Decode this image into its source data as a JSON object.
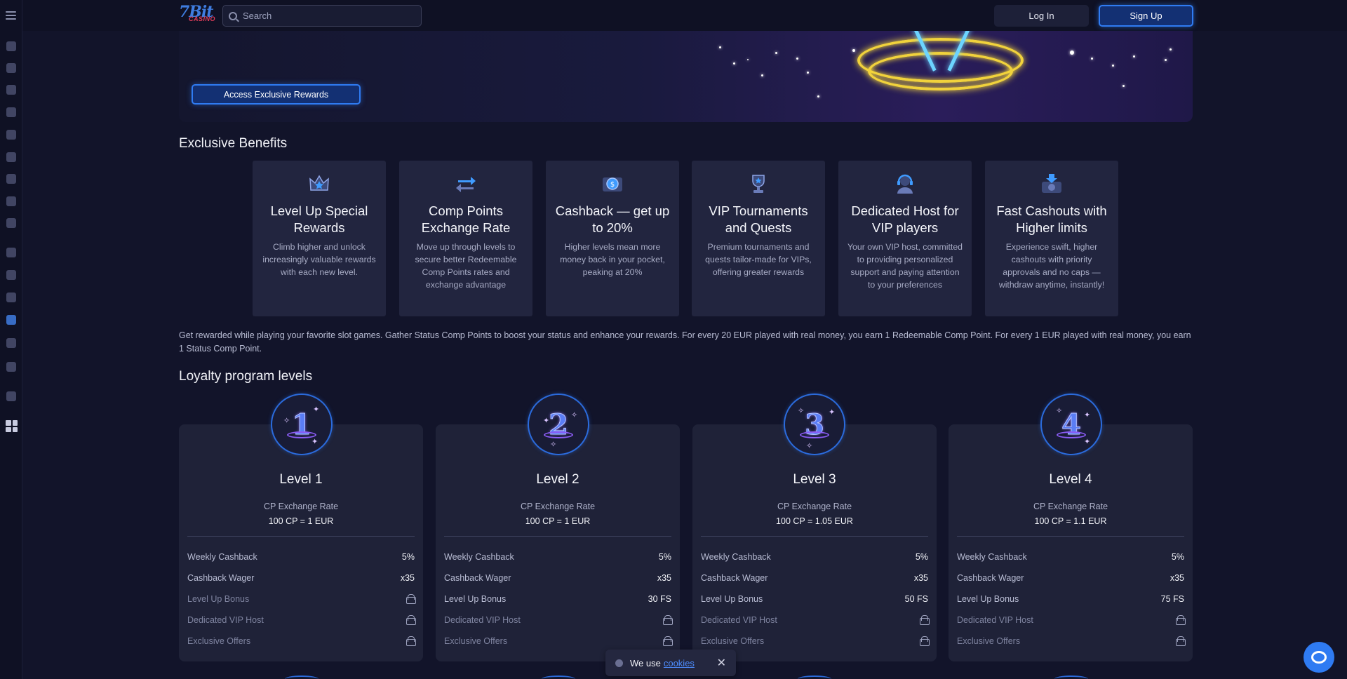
{
  "header": {
    "logo_text": "7Bit",
    "logo_sub": "CASINO",
    "search_placeholder": "Search",
    "login_label": "Log In",
    "signup_label": "Sign Up"
  },
  "hero": {
    "cta_label": "Access Exclusive Rewards"
  },
  "benefits": {
    "title": "Exclusive Benefits",
    "items": [
      {
        "icon": "crown-icon",
        "title": "Level Up Special Rewards",
        "text": "Climb higher and unlock increasingly valuable rewards with each new level."
      },
      {
        "icon": "exchange-arrows-icon",
        "title": "Comp Points Exchange Rate",
        "text": "Move up through levels to secure better Redeemable Comp Points rates and exchange advantage"
      },
      {
        "icon": "cashback-coin-icon",
        "title": "Cashback — get up to 20%",
        "text": "Higher levels mean more money back in your pocket, peaking at 20%"
      },
      {
        "icon": "trophy-icon",
        "title": "VIP Tournaments and Quests",
        "text": "Premium tournaments and quests tailor-made for VIPs, offering greater rewards"
      },
      {
        "icon": "support-agent-icon",
        "title": "Dedicated Host for VIP players",
        "text": "Your own VIP host, committed to providing personalized support and paying attention to your preferences"
      },
      {
        "icon": "cash-out-icon",
        "title": "Fast Cashouts with Higher limits",
        "text": "Experience swift, higher cashouts with priority approvals and no caps — withdraw anytime, instantly!"
      }
    ]
  },
  "description": "Get rewarded while playing your favorite slot games. Gather Status Comp Points to boost your status and enhance your rewards. For every 20 EUR played with real money, you earn 1 Redeemable Comp Point. For every 1 EUR played with real money, you earn 1 Status Comp Point.",
  "levels": {
    "title": "Loyalty program levels",
    "cp_label": "CP Exchange Rate",
    "row_labels": {
      "weekly_cashback": "Weekly Cashback",
      "cashback_wager": "Cashback Wager",
      "level_up_bonus": "Level Up Bonus",
      "vip_host": "Dedicated VIP Host",
      "exclusive_offers": "Exclusive Offers"
    },
    "items": [
      {
        "number": "1",
        "name": "Level 1",
        "cp_rate": "100 CP = 1 EUR",
        "weekly_cashback": "5%",
        "cashback_wager": "x35",
        "level_up_bonus": null
      },
      {
        "number": "2",
        "name": "Level 2",
        "cp_rate": "100 CP = 1 EUR",
        "weekly_cashback": "5%",
        "cashback_wager": "x35",
        "level_up_bonus": "30 FS"
      },
      {
        "number": "3",
        "name": "Level 3",
        "cp_rate": "100 CP = 1.05 EUR",
        "weekly_cashback": "5%",
        "cashback_wager": "x35",
        "level_up_bonus": "50 FS"
      },
      {
        "number": "4",
        "name": "Level 4",
        "cp_rate": "100 CP = 1.1 EUR",
        "weekly_cashback": "5%",
        "cashback_wager": "x35",
        "level_up_bonus": "75 FS"
      }
    ]
  },
  "cookie": {
    "text": "We use",
    "link": "cookies",
    "close": "✕"
  },
  "sidebar_icons": [
    "flame-icon",
    "slots-icon",
    "fire-icon",
    "roulette-icon",
    "bonus-icon",
    "cherries-icon",
    "live-dealer-icon",
    "rocket-icon",
    "cards-icon",
    "gift-icon",
    "trophy-icon",
    "chip-icon",
    "crown-icon",
    "card-icon",
    "helmet-icon",
    "download-icon",
    "language-flag-icon"
  ],
  "colors": {
    "accent": "#2f7bf2",
    "background": "#12142a",
    "card": "#22253f"
  }
}
